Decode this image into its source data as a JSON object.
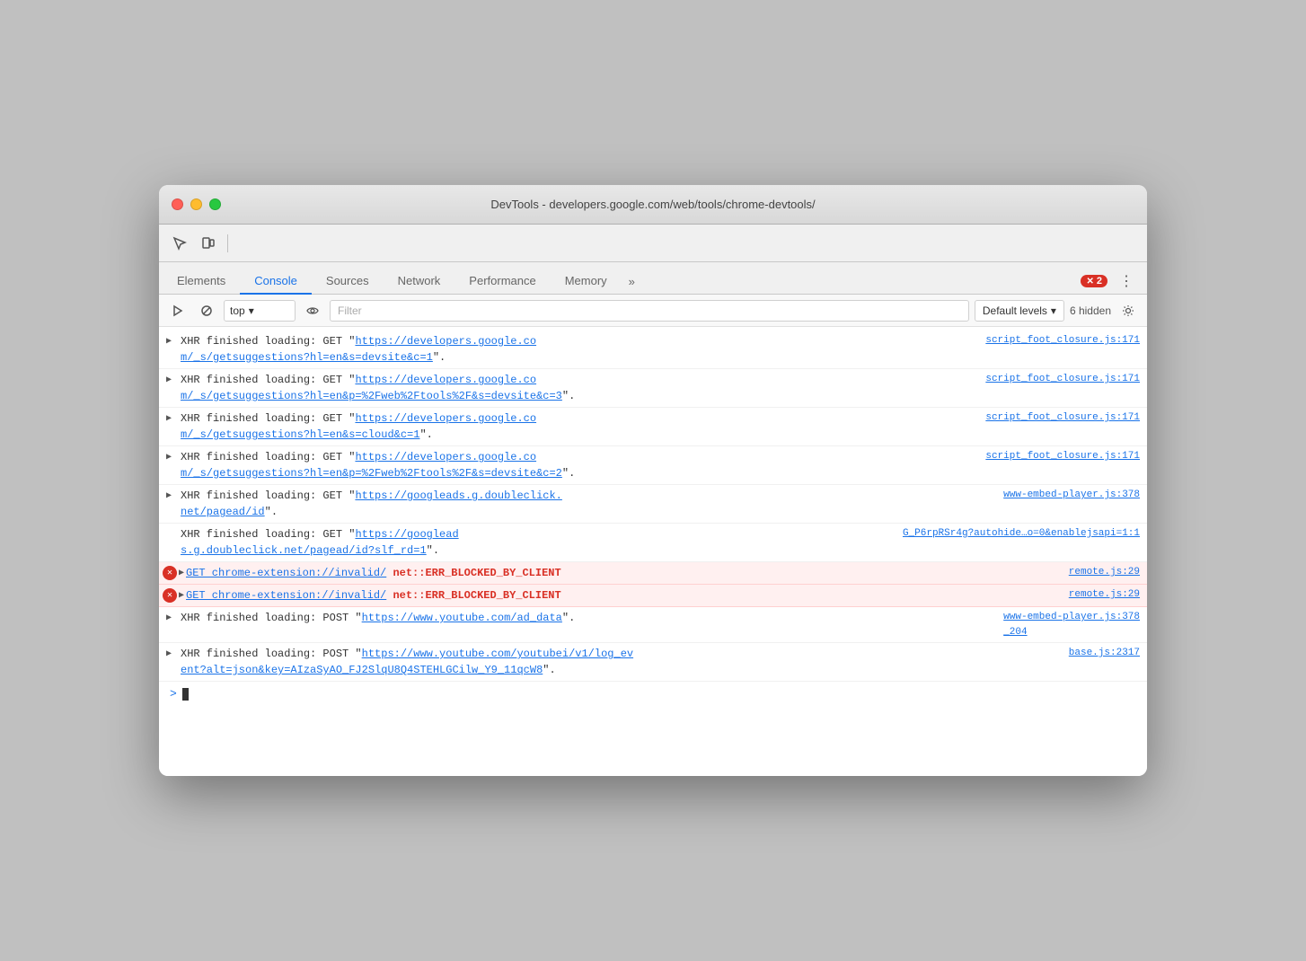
{
  "window": {
    "title": "DevTools - developers.google.com/web/tools/chrome-devtools/"
  },
  "tabs": {
    "items": [
      {
        "label": "Elements",
        "active": false
      },
      {
        "label": "Console",
        "active": true
      },
      {
        "label": "Sources",
        "active": false
      },
      {
        "label": "Network",
        "active": false
      },
      {
        "label": "Performance",
        "active": false
      },
      {
        "label": "Memory",
        "active": false
      }
    ],
    "more_label": "»",
    "error_count": "2",
    "kebab_icon": "⋮"
  },
  "console_toolbar": {
    "execute_label": "▶",
    "block_label": "⊘",
    "context_value": "top",
    "context_arrow": "▾",
    "eye_icon": "👁",
    "filter_placeholder": "Filter",
    "levels_label": "Default levels",
    "levels_arrow": "▾",
    "hidden_label": "6 hidden",
    "settings_icon": "⚙"
  },
  "entries": [
    {
      "type": "xhr",
      "icon": "▶",
      "text": "XHR finished loading: GET \"",
      "link": "https://developers.google.co\nm/_s/getsuggestions?hl=en&s=devsite&c=1",
      "text2": "\".",
      "source": "script_foot_closure.js:171"
    },
    {
      "type": "xhr",
      "icon": "▶",
      "text": "XHR finished loading: GET \"",
      "link": "https://developers.google.co\nm/_s/getsuggestions?hl=en&p=%2Fweb%2Ftools%2F&s=devsite&c=3",
      "text2": "\".",
      "source": "script_foot_closure.js:171"
    },
    {
      "type": "xhr",
      "icon": "▶",
      "text": "XHR finished loading: GET \"",
      "link": "https://developers.google.co\nm/_s/getsuggestions?hl=en&s=cloud&c=1",
      "text2": "\".",
      "source": "script_foot_closure.js:171"
    },
    {
      "type": "xhr",
      "icon": "▶",
      "text": "XHR finished loading: GET \"",
      "link": "https://developers.google.co\nm/_s/getsuggestions?hl=en&p=%2Fweb%2Ftools%2F&s=devsite&c=2",
      "text2": "\".",
      "source": "script_foot_closure.js:171"
    },
    {
      "type": "xhr",
      "icon": "▶",
      "text": "XHR finished loading: GET \"",
      "link": "https://googleads.g.doubleclick.\nnet/pagead/id",
      "text2": "\".",
      "source": "www-embed-player.js:378"
    },
    {
      "type": "xhr_plain",
      "text": "XHR finished loading: GET \"",
      "link": "https://googlead\ns.g.doubleclick.net/pagead/id?slf_rd=1",
      "text2": "\".",
      "source": "G_P6rpRSr4g?autohide…o=0&enablejsapi=1:1"
    },
    {
      "type": "error",
      "icon": "▶",
      "get_text": "GET chrome-extension://invalid/",
      "err_text": "net::ERR_BLOCKED_BY_CLIENT",
      "source": "remote.js:29"
    },
    {
      "type": "error",
      "icon": "▶",
      "get_text": "GET chrome-extension://invalid/",
      "err_text": "net::ERR_BLOCKED_BY_CLIENT",
      "source": "remote.js:29"
    },
    {
      "type": "xhr",
      "icon": "▶",
      "text": "XHR finished loading: POST \"",
      "link": "https://www.youtube.com/ad_data",
      "text2": "\".",
      "source": "www-embed-player.js:378\n_204"
    },
    {
      "type": "xhr",
      "icon": "▶",
      "text": "XHR finished loading: POST \"",
      "link": "https://www.youtube.com/youtubei/v1/log_ev\nent?alt=json&key=AIzaSyAO_FJ2SlqU8Q4STEHLGCilw_Y9_11qcW8",
      "text2": "\".",
      "source": "base.js:2317"
    }
  ]
}
